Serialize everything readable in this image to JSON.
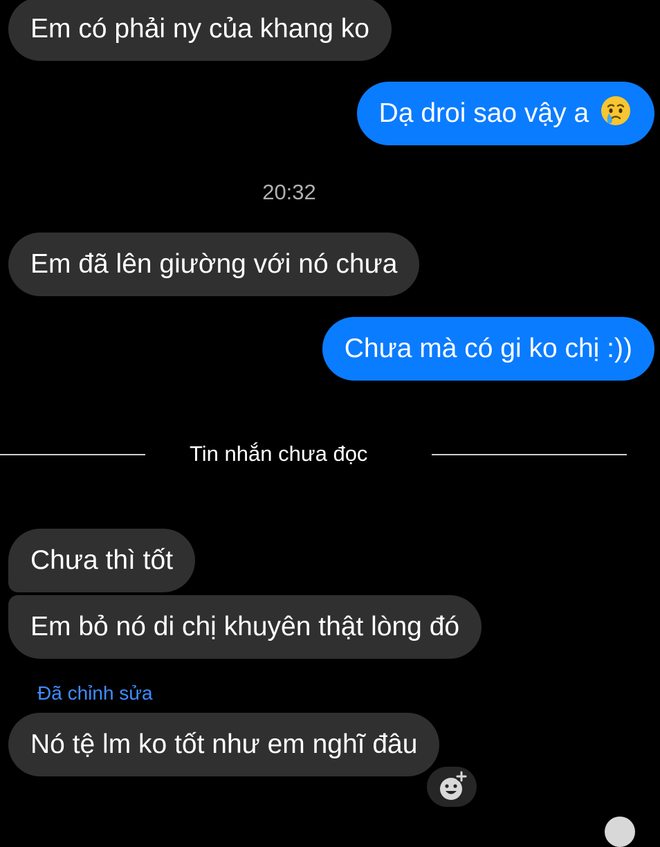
{
  "messages": [
    {
      "text": "Em có phải ny của khang ko",
      "direction": "incoming"
    },
    {
      "text": "Dạ droi sao vậy a",
      "direction": "outgoing",
      "emoji": "crying-face-emoji"
    },
    {
      "text": "Em đã lên giường với nó chưa",
      "direction": "incoming"
    },
    {
      "text": "Chưa mà có gi ko chị :))",
      "direction": "outgoing"
    },
    {
      "text": "Chưa thì tốt",
      "direction": "incoming"
    },
    {
      "text": "Em bỏ nó di chị khuyên thật lòng đó",
      "direction": "incoming"
    },
    {
      "text": "Nó tệ lm ko tốt như em nghĩ đâu",
      "direction": "incoming",
      "edited": true
    }
  ],
  "timestamp": "20:32",
  "unread_divider": "Tin nhắn chưa đọc",
  "edited_label": "Đã chỉnh sửa",
  "icons": {
    "reaction": "add-reaction-icon",
    "avatar": "avatar-icon"
  },
  "colors": {
    "background": "#000000",
    "incoming_bubble": "#303030",
    "outgoing_bubble": "#0a7cff",
    "edited_label": "#3f8cff",
    "timestamp": "#b0b0b0"
  }
}
